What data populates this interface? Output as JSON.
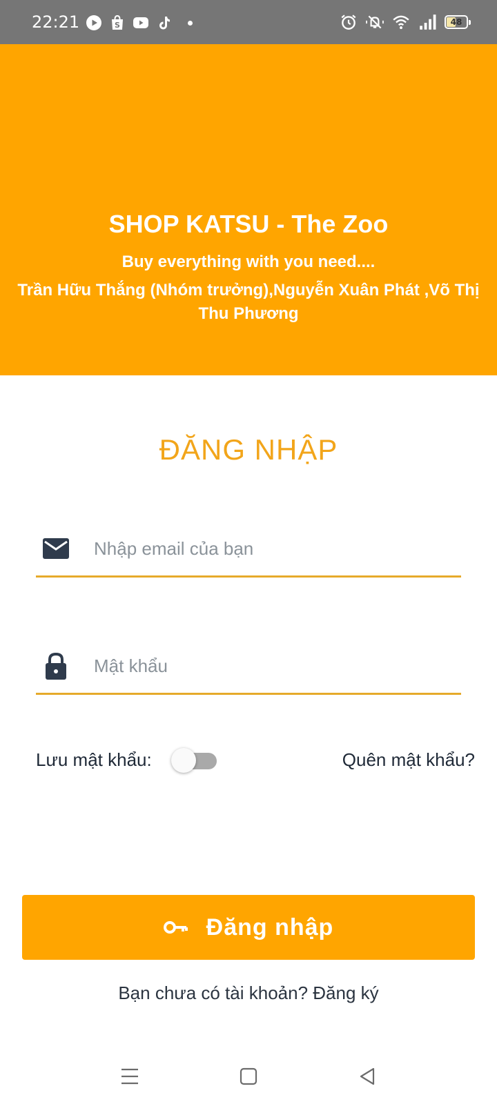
{
  "status_bar": {
    "time": "22:21",
    "battery_level": "48",
    "battery_fraction": 0.48,
    "app_icons": [
      "play-icon",
      "shopee-icon",
      "youtube-icon",
      "tiktok-icon",
      "notification-dot"
    ],
    "system_icons": [
      "alarm-icon",
      "mute-vibrate-icon",
      "wifi-icon",
      "signal-icon",
      "battery-icon"
    ]
  },
  "banner": {
    "title": "SHOP KATSU - The Zoo",
    "subtitle": "Buy everything with you need....",
    "members": "Trần Hữu Thắng (Nhóm trưởng),Nguyễn Xuân Phát ,Võ Thị Thu Phương",
    "background": "#ffa500"
  },
  "login": {
    "title": "ĐĂNG NHẬP",
    "email": {
      "placeholder": "Nhập email của bạn",
      "value": "",
      "icon": "mail-icon"
    },
    "password": {
      "placeholder": "Mật khẩu",
      "value": "",
      "icon": "lock-icon"
    },
    "remember_label": "Lưu mật khẩu:",
    "remember_on": false,
    "forgot_label": "Quên mật khẩu?",
    "button_label": "Đăng nhập",
    "button_icon": "key-icon",
    "signup_text": "Bạn chưa có tài khoản? Đăng ký",
    "accent": "#f2a51a"
  },
  "nav_bar": {
    "items": [
      "menu-icon",
      "home-icon",
      "back-icon"
    ]
  }
}
